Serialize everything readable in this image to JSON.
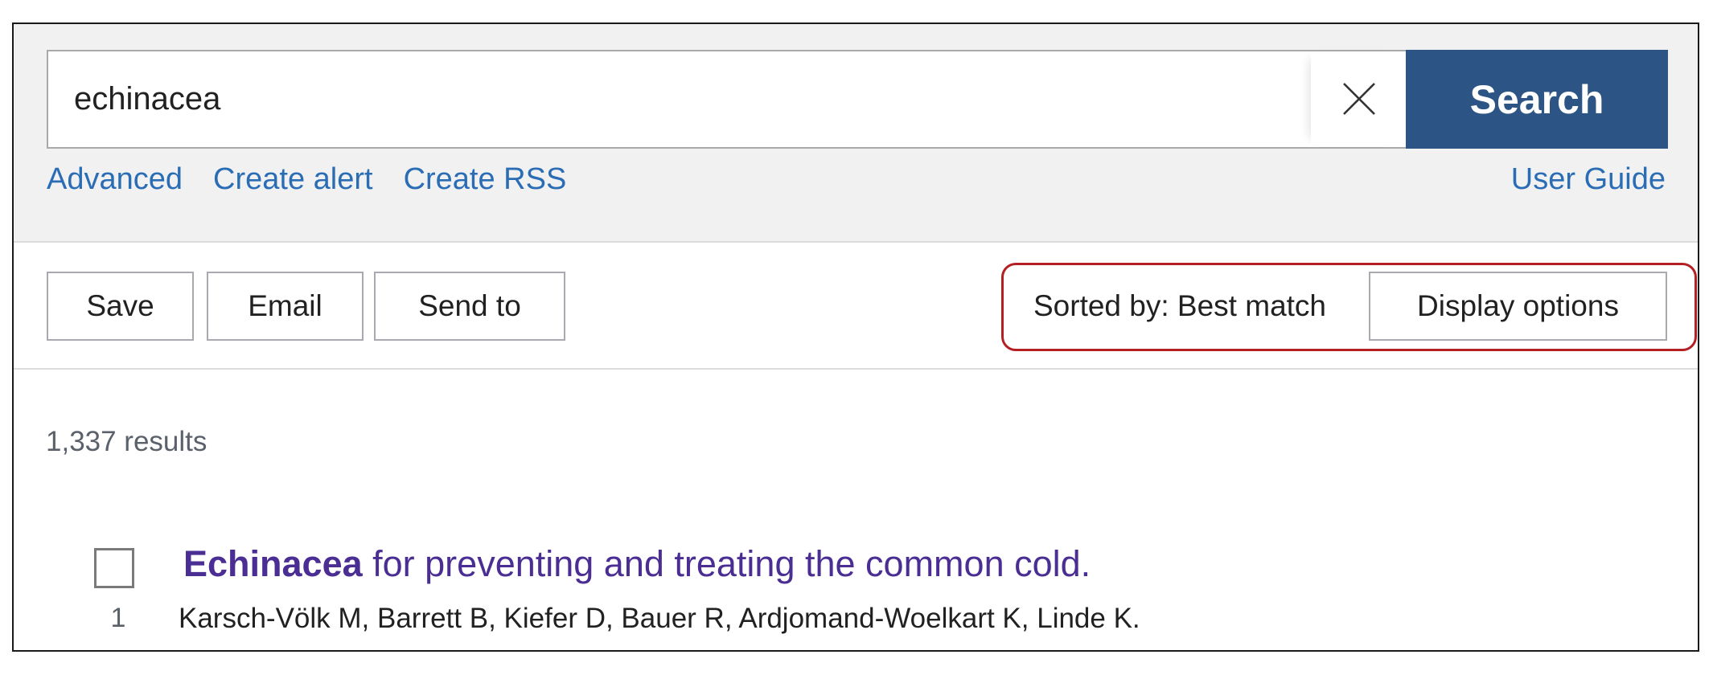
{
  "search": {
    "query": "echinacea",
    "clear_icon": "close-icon",
    "search_label": "Search",
    "links": [
      {
        "label": "Advanced"
      },
      {
        "label": "Create alert"
      },
      {
        "label": "Create RSS"
      }
    ],
    "user_guide_label": "User Guide"
  },
  "toolbar": {
    "save_label": "Save",
    "email_label": "Email",
    "send_to_label": "Send to",
    "sorted_by_label": "Sorted by: Best match",
    "display_options_label": "Display options",
    "highlight_color": "#b51f24"
  },
  "results": {
    "count_text": "1,337 results",
    "items": [
      {
        "index": "1",
        "title_highlight": "Echinacea",
        "title_rest": " for preventing and treating the common cold.",
        "authors": "Karsch-Völk M, Barrett B, Kiefer D, Bauer R, Ardjomand-Woelkart K, Linde K.",
        "checked": false
      }
    ]
  },
  "colors": {
    "header_bg": "#f1f1f1",
    "search_button_bg": "#2c5485",
    "link": "#2a6db5",
    "title_link": "#4b2e93",
    "muted_text": "#5b616b"
  }
}
